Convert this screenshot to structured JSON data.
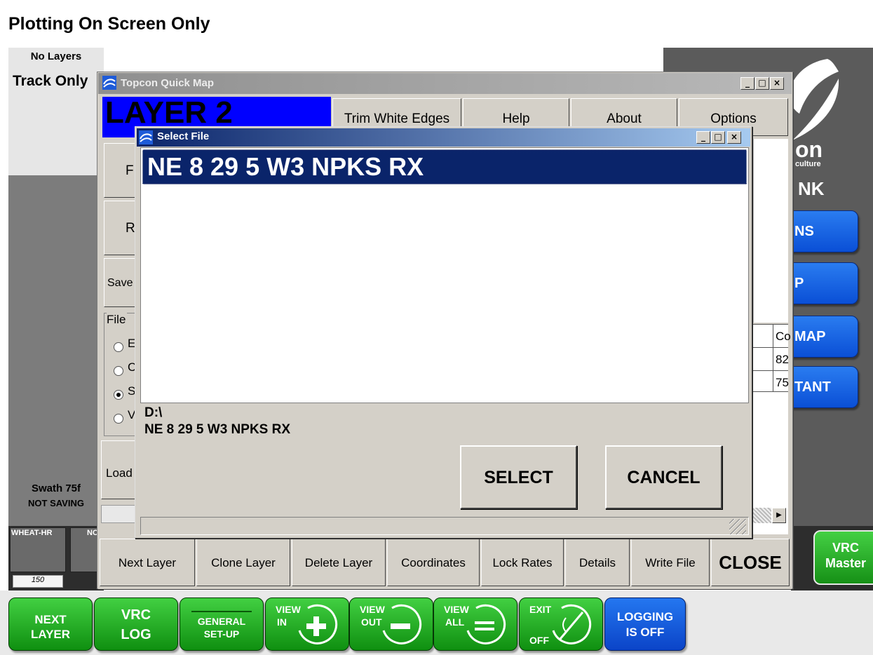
{
  "app": {
    "title": "Plotting On Screen Only",
    "no_layers": "No Layers",
    "track_only": "Track Only",
    "swath": "Swath 75f",
    "not_saving": "NOT SAVING",
    "brand_fragment_1": "on",
    "brand_fragment_2": "culture",
    "brand_fragment_3": "NK"
  },
  "right_menu": [
    "NS",
    "P",
    "MAP",
    "TANT"
  ],
  "field_tiles": {
    "tile1_label": "WHEAT-HR",
    "tile2_label": "NC",
    "tile1_value": "150"
  },
  "vrc_master": {
    "line1": "VRC",
    "line2": "Master"
  },
  "bottom_toolbar": {
    "next_layer": [
      "NEXT",
      "LAYER"
    ],
    "vrc_log": [
      "VRC",
      "LOG"
    ],
    "general_setup": [
      "GENERAL",
      "SET-UP"
    ],
    "view_in": [
      "VIEW",
      "IN"
    ],
    "view_out": [
      "VIEW",
      "OUT"
    ],
    "view_all": [
      "VIEW",
      "ALL"
    ],
    "exit_off": [
      "EXIT",
      "OFF"
    ],
    "logging": [
      "LOGGING",
      "IS OFF"
    ]
  },
  "quick_map": {
    "title": "Topcon Quick Map",
    "layer_label": "LAYER 2",
    "top_buttons": [
      "Trim White Edges",
      "Help",
      "About",
      "Options"
    ],
    "side_buttons": [
      "F",
      "R",
      "Save"
    ],
    "file_group_label": "File",
    "radio_options": [
      "E",
      "C",
      "S",
      "V"
    ],
    "load_button": "Load",
    "grid_values": [
      "Co",
      "82",
      "75"
    ],
    "bottom_buttons": [
      "Next Layer",
      "Clone Layer",
      "Delete Layer",
      "Coordinates",
      "Lock Rates",
      "Details",
      "Write File",
      "CLOSE"
    ]
  },
  "select_file": {
    "title": "Select File",
    "selected_item": "NE 8 29 5 W3 NPKS RX",
    "path": "D:\\",
    "filename": "NE 8 29 5 W3 NPKS RX",
    "select_label": "SELECT",
    "cancel_label": "CANCEL"
  },
  "window_controls": {
    "minimize": "_",
    "maximize": "□",
    "close": "×"
  }
}
